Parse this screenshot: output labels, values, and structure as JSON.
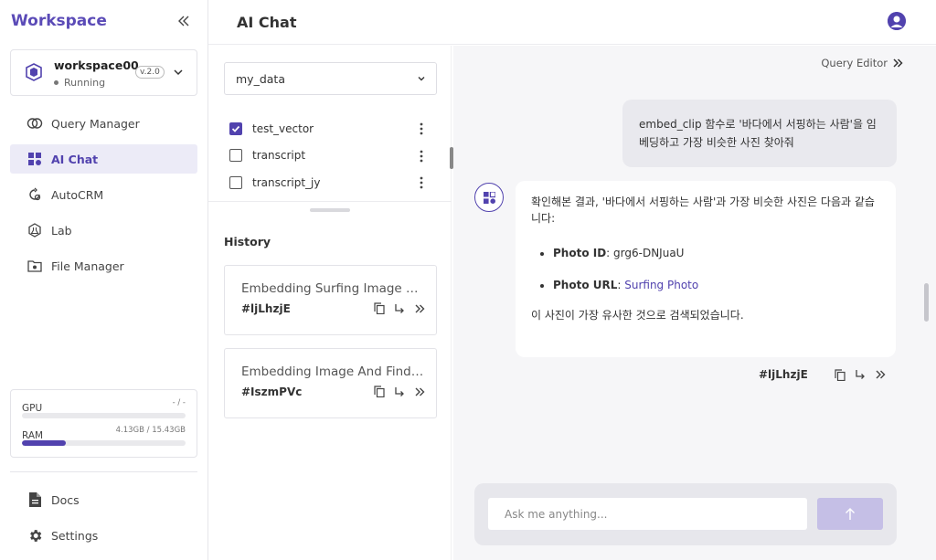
{
  "app": {
    "brand": "Workspace"
  },
  "workspace": {
    "name": "workspace00",
    "status": "Running",
    "version": "v.2.0"
  },
  "sidebar": {
    "items": [
      {
        "label": "Query Manager",
        "icon": "query-manager-icon"
      },
      {
        "label": "AI Chat",
        "icon": "ai-chat-icon",
        "active": true
      },
      {
        "label": "AutoCRM",
        "icon": "autocrm-icon"
      },
      {
        "label": "Lab",
        "icon": "lab-icon"
      },
      {
        "label": "File Manager",
        "icon": "file-manager-icon"
      }
    ],
    "bottom": [
      {
        "label": "Docs",
        "icon": "docs-icon"
      },
      {
        "label": "Settings",
        "icon": "gear-icon"
      }
    ]
  },
  "resources": {
    "gpu": {
      "label": "GPU",
      "value": "- / -",
      "fraction": 0
    },
    "ram": {
      "label": "RAM",
      "value": "4.13GB / 15.43GB",
      "fraction": 0.27
    }
  },
  "header": {
    "title": "AI Chat"
  },
  "data_panel": {
    "database": "my_data",
    "tables": [
      {
        "name": "test_vector",
        "checked": true
      },
      {
        "name": "transcript",
        "checked": false
      },
      {
        "name": "transcript_jy",
        "checked": false
      }
    ]
  },
  "history": {
    "title": "History",
    "items": [
      {
        "title": "Embedding Surfing Image and Find Similar",
        "id": "#ljLhzjE"
      },
      {
        "title": "Embedding Image And Find Similar",
        "id": "#IszmPVc"
      }
    ]
  },
  "chat": {
    "query_editor_label": "Query Editor",
    "user_message": "embed_clip 함수로 '바다에서 서핑하는 사람'을 임베딩하고 가장 비슷한 사진 찾아줘",
    "bot_intro": "확인해본 결과, '바다에서 서핑하는 사람'과 가장 비슷한 사진은 다음과 같습니다:",
    "photo_id_label": "Photo ID",
    "photo_id_value": "grg6-DNJuaU",
    "photo_url_label": "Photo URL",
    "photo_url_value": "Surfing Photo",
    "bot_outro": "이 사진이 가장 유사한 것으로 검색되었습니다.",
    "bot_message_id": "#ljLhzjE",
    "input_placeholder": "Ask me anything..."
  },
  "colors": {
    "accent": "#5142ae",
    "brand": "#5b4bb7"
  }
}
